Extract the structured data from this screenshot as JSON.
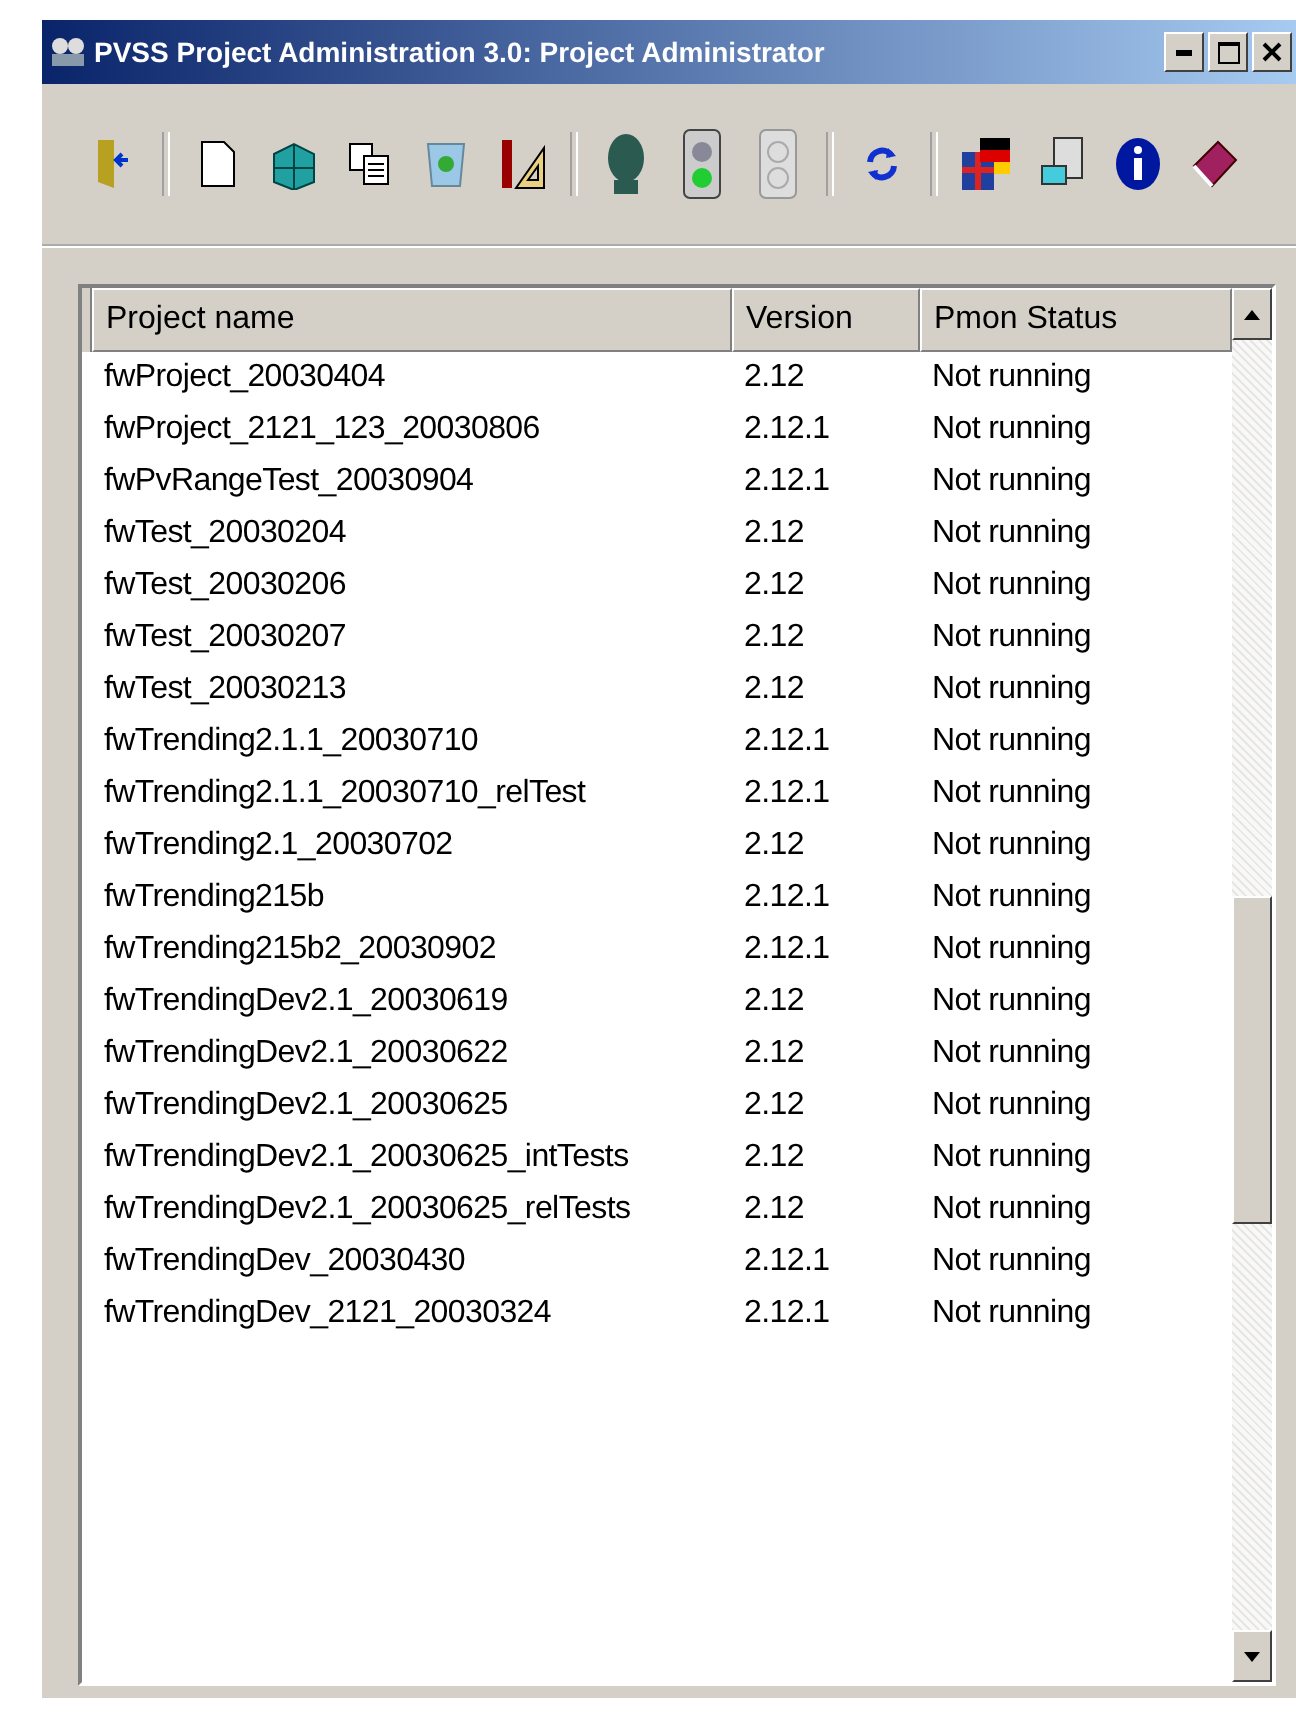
{
  "window": {
    "title": "PVSS Project Administration 3.0: Project Administrator"
  },
  "table": {
    "columns": [
      "Project name",
      "Version",
      "Pmon Status"
    ],
    "rows": [
      {
        "name": "fwProject_20030404",
        "version": "2.12",
        "status": "Not running"
      },
      {
        "name": "fwProject_2121_123_20030806",
        "version": "2.12.1",
        "status": "Not running"
      },
      {
        "name": "fwPvRangeTest_20030904",
        "version": "2.12.1",
        "status": "Not running"
      },
      {
        "name": "fwTest_20030204",
        "version": "2.12",
        "status": "Not running"
      },
      {
        "name": "fwTest_20030206",
        "version": "2.12",
        "status": "Not running"
      },
      {
        "name": "fwTest_20030207",
        "version": "2.12",
        "status": "Not running"
      },
      {
        "name": "fwTest_20030213",
        "version": "2.12",
        "status": "Not running"
      },
      {
        "name": "fwTrending2.1.1_20030710",
        "version": "2.12.1",
        "status": "Not running"
      },
      {
        "name": "fwTrending2.1.1_20030710_relTest",
        "version": "2.12.1",
        "status": "Not running"
      },
      {
        "name": "fwTrending2.1_20030702",
        "version": "2.12",
        "status": "Not running"
      },
      {
        "name": "fwTrending215b",
        "version": "2.12.1",
        "status": "Not running"
      },
      {
        "name": "fwTrending215b2_20030902",
        "version": "2.12.1",
        "status": "Not running"
      },
      {
        "name": "fwTrendingDev2.1_20030619",
        "version": "2.12",
        "status": "Not running"
      },
      {
        "name": "fwTrendingDev2.1_20030622",
        "version": "2.12",
        "status": "Not running"
      },
      {
        "name": "fwTrendingDev2.1_20030625",
        "version": "2.12",
        "status": "Not running"
      },
      {
        "name": "fwTrendingDev2.1_20030625_intTests",
        "version": "2.12",
        "status": "Not running"
      },
      {
        "name": "fwTrendingDev2.1_20030625_relTests",
        "version": "2.12",
        "status": "Not running"
      },
      {
        "name": "fwTrendingDev_20030430",
        "version": "2.12.1",
        "status": "Not running"
      },
      {
        "name": "fwTrendingDev_2121_20030324",
        "version": "2.12.1",
        "status": "Not running"
      }
    ]
  }
}
